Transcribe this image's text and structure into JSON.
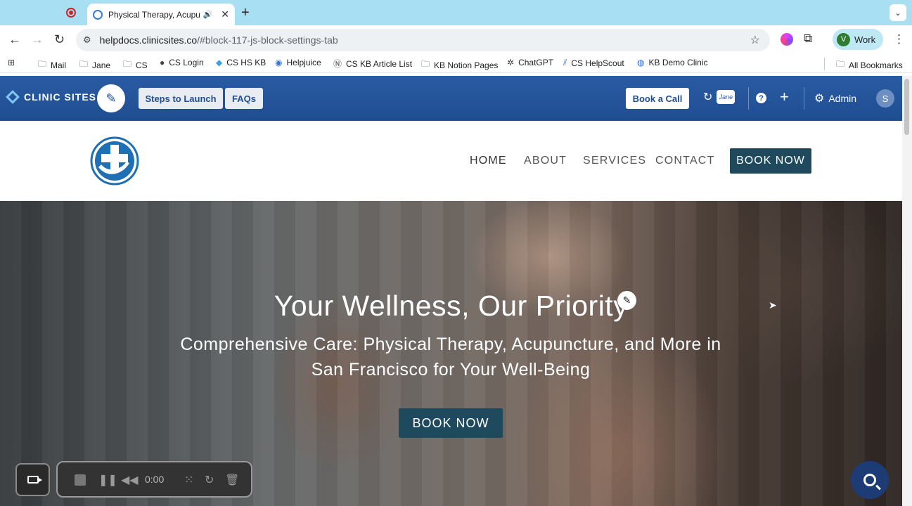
{
  "browser": {
    "tab_title": "Physical Therapy, Acupun",
    "url_host": "helpdocs.clinicsites.co",
    "url_path": "/#block-117-js-block-settings-tab",
    "profile_initial": "V",
    "profile_label": "Work"
  },
  "bookmarks": [
    {
      "label": "Mail",
      "icon": "folder-icon"
    },
    {
      "label": "Jane",
      "icon": "folder-icon"
    },
    {
      "label": "CS",
      "icon": "folder-icon"
    },
    {
      "label": "CS Login",
      "icon": "globe-icon"
    },
    {
      "label": "CS HS KB",
      "icon": "diamond-icon"
    },
    {
      "label": "Helpjuice",
      "icon": "helpjuice-icon"
    },
    {
      "label": "CS KB Article List",
      "icon": "notion-icon"
    },
    {
      "label": "KB Notion Pages",
      "icon": "folder-icon"
    },
    {
      "label": "ChatGPT",
      "icon": "chatgpt-icon"
    },
    {
      "label": "CS HelpScout",
      "icon": "helpscout-icon"
    },
    {
      "label": "KB Demo Clinic",
      "icon": "globe-icon"
    }
  ],
  "all_bookmarks": "All Bookmarks",
  "adminbar": {
    "brand": "CLINIC SITES",
    "steps_label": "Steps to Launch",
    "faqs_label": "FAQs",
    "book_call_label": "Book a Call",
    "jane_badge": "Jane",
    "admin_label": "Admin",
    "user_initial": "S"
  },
  "nav": {
    "home": "HOME",
    "about": "ABOUT",
    "services": "SERVICES",
    "contact": "CONTACT",
    "book": "BOOK NOW"
  },
  "hero": {
    "title": "Your Wellness, Our Priority",
    "subtitle": "Comprehensive Care: Physical Therapy, Acupuncture, and More in San Francisco for Your Well-Being",
    "button": "BOOK NOW"
  },
  "recorder": {
    "time": "0:00"
  },
  "colors": {
    "admin_bar": "#1f4d92",
    "brand_button": "#1f4a5e",
    "tab_strip": "#a9dff2"
  }
}
